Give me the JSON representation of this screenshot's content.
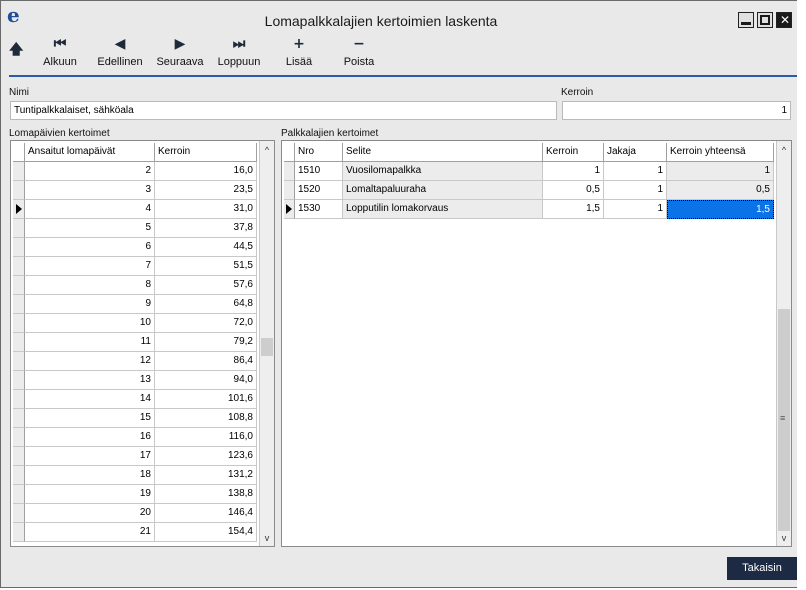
{
  "window": {
    "title": "Lomapalkkalajien kertoimien laskenta",
    "app_icon": "e",
    "close_glyph": "✕"
  },
  "toolbar": {
    "up_icon": "🡅",
    "items": [
      {
        "label": "Alkuun",
        "icon": "first-record-icon",
        "glyph": "⏮"
      },
      {
        "label": "Edellinen",
        "icon": "previous-record-icon",
        "glyph": "◀"
      },
      {
        "label": "Seuraava",
        "icon": "next-record-icon",
        "glyph": "▶"
      },
      {
        "label": "Loppuun",
        "icon": "last-record-icon",
        "glyph": "⏭"
      },
      {
        "label": "Lisää",
        "icon": "plus-icon",
        "glyph": "+"
      },
      {
        "label": "Poista",
        "icon": "minus-icon",
        "glyph": "−"
      }
    ]
  },
  "form": {
    "name_label": "Nimi",
    "name_value": "Tuntipalkkalaiset, sähköala",
    "factor_label": "Kerroin",
    "factor_value": "1"
  },
  "left_grid": {
    "title": "Lomapäivien kertoimet",
    "headers": [
      "Ansaitut lomapäivät",
      "Kerroin"
    ],
    "selected_index": 2,
    "rows": [
      [
        "2",
        "16,0"
      ],
      [
        "3",
        "23,5"
      ],
      [
        "4",
        "31,0"
      ],
      [
        "5",
        "37,8"
      ],
      [
        "6",
        "44,5"
      ],
      [
        "7",
        "51,5"
      ],
      [
        "8",
        "57,6"
      ],
      [
        "9",
        "64,8"
      ],
      [
        "10",
        "72,0"
      ],
      [
        "11",
        "79,2"
      ],
      [
        "12",
        "86,4"
      ],
      [
        "13",
        "94,0"
      ],
      [
        "14",
        "101,6"
      ],
      [
        "15",
        "108,8"
      ],
      [
        "16",
        "116,0"
      ],
      [
        "17",
        "123,6"
      ],
      [
        "18",
        "131,2"
      ],
      [
        "19",
        "138,8"
      ],
      [
        "20",
        "146,4"
      ],
      [
        "21",
        "154,4"
      ]
    ]
  },
  "right_grid": {
    "title": "Palkkalajien kertoimet",
    "headers": [
      "Nro",
      "Selite",
      "Kerroin",
      "Jakaja",
      "Kerroin yhteensä"
    ],
    "selected_index": 2,
    "rows": [
      [
        "1510",
        "Vuosilomapalkka",
        "1",
        "1",
        "1"
      ],
      [
        "1520",
        "Lomaltapaluuraha",
        "0,5",
        "1",
        "0,5"
      ],
      [
        "1530",
        "Lopputilin lomakorvaus",
        "1,5",
        "1",
        "1,5"
      ]
    ]
  },
  "scroll": {
    "up": "^",
    "down": "v",
    "grip": "≡"
  },
  "footer": {
    "back_label": "Takaisin"
  }
}
